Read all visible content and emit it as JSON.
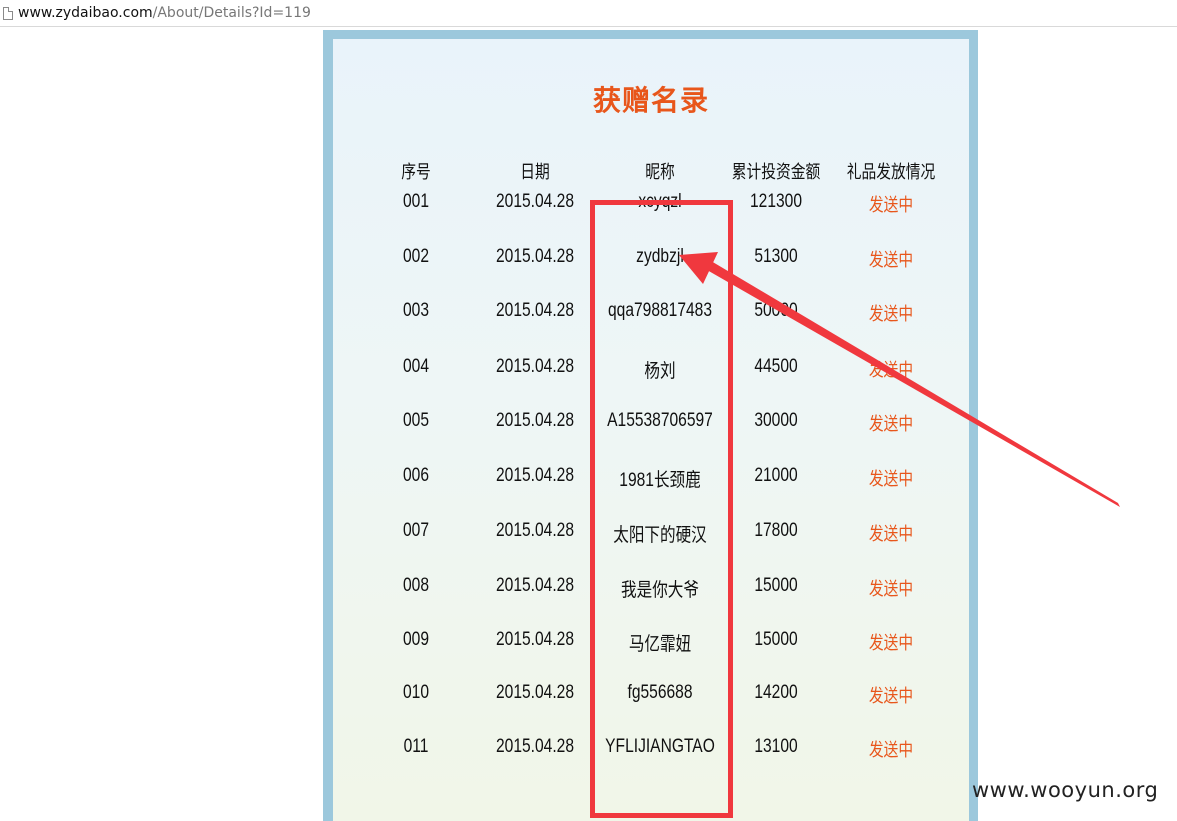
{
  "browser": {
    "url_host": "www.zydaibao.com",
    "url_path": "/About/Details?Id=119"
  },
  "page": {
    "title": "获赠名录",
    "headers": [
      "序号",
      "日期",
      "昵称",
      "累计投资金额",
      "礼品发放情况"
    ],
    "rows": [
      {
        "idx": "001",
        "date": "2015.04.28",
        "nick": "xcyqzl",
        "amount": "121300",
        "status": "发送中"
      },
      {
        "idx": "002",
        "date": "2015.04.28",
        "nick": "zydbzjl",
        "amount": "51300",
        "status": "发送中"
      },
      {
        "idx": "003",
        "date": "2015.04.28",
        "nick": "qqa798817483",
        "amount": "50000",
        "status": "发送中"
      },
      {
        "idx": "004",
        "date": "2015.04.28",
        "nick": "杨刘",
        "amount": "44500",
        "status": "发送中"
      },
      {
        "idx": "005",
        "date": "2015.04.28",
        "nick": "A15538706597",
        "amount": "30000",
        "status": "发送中"
      },
      {
        "idx": "006",
        "date": "2015.04.28",
        "nick": "1981长颈鹿",
        "amount": "21000",
        "status": "发送中"
      },
      {
        "idx": "007",
        "date": "2015.04.28",
        "nick": "太阳下的硬汉",
        "amount": "17800",
        "status": "发送中"
      },
      {
        "idx": "008",
        "date": "2015.04.28",
        "nick": "我是你大爷",
        "amount": "15000",
        "status": "发送中"
      },
      {
        "idx": "009",
        "date": "2015.04.28",
        "nick": "马亿霏妞",
        "amount": "15000",
        "status": "发送中"
      },
      {
        "idx": "010",
        "date": "2015.04.28",
        "nick": "fg556688",
        "amount": "14200",
        "status": "发送中"
      },
      {
        "idx": "011",
        "date": "2015.04.28",
        "nick": "YFLIJIANGTAO",
        "amount": "13100",
        "status": "发送中"
      }
    ]
  },
  "watermark": "www.wooyun.org",
  "colors": {
    "title": "#e8561b",
    "status": "#e8561b",
    "panel_border": "#9cc8dc",
    "annotation": "#f0383e"
  }
}
